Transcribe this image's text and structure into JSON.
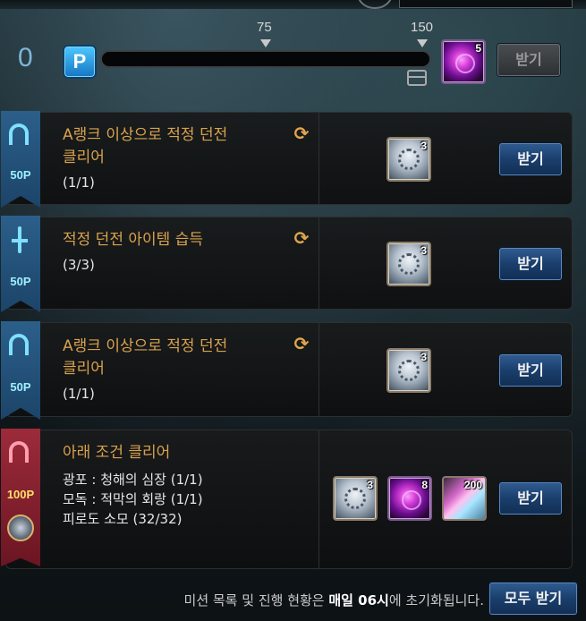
{
  "progress": {
    "points": "0",
    "points_icon": "P",
    "progress_fraction": 0,
    "milestones": [
      "75",
      "150"
    ],
    "reward_count": "5",
    "claim_label": "받기",
    "claim_enabled": false
  },
  "missions": [
    {
      "points": "50P",
      "emblem": "arch-icon",
      "ribbon_color": "#2b5f8a",
      "title_lines": [
        "A랭크 이상으로 적정 던전",
        "클리어"
      ],
      "progress": "(1/1)",
      "reward_count": "3",
      "claim_label": "받기"
    },
    {
      "points": "50P",
      "emblem": "sword-icon",
      "ribbon_color": "#2b5f8a",
      "title_lines": [
        "적정 던전 아이템 습득"
      ],
      "progress": "(3/3)",
      "reward_count": "3",
      "claim_label": "받기"
    },
    {
      "points": "50P",
      "emblem": "arch-icon",
      "ribbon_color": "#2b5f8a",
      "title_lines": [
        "A랭크 이상으로 적정 던전",
        "클리어"
      ],
      "progress": "(1/1)",
      "reward_count": "3",
      "claim_label": "받기"
    },
    {
      "points": "100P",
      "emblem": "arch-icon",
      "ribbon_color": "#9c2b3a",
      "title_lines": [
        "아래 조건 클리어"
      ],
      "conditions": [
        "광포 : 청해의 심장 (1/1)",
        "모독 : 적막의 회랑 (1/1)",
        "피로도 소모 (32/32)"
      ],
      "rewards": [
        {
          "icon": "badge-icon",
          "count": "3"
        },
        {
          "icon": "orb-icon",
          "count": "8"
        },
        {
          "icon": "gem-icon",
          "count": "200"
        }
      ],
      "claim_label": "받기"
    }
  ],
  "footer": {
    "notice_prefix": "미션 목록 및 진행 현황은 ",
    "notice_bold": "매일 06시",
    "notice_suffix": "에 초기화됩니다.",
    "claim_all_label": "모두 받기"
  }
}
